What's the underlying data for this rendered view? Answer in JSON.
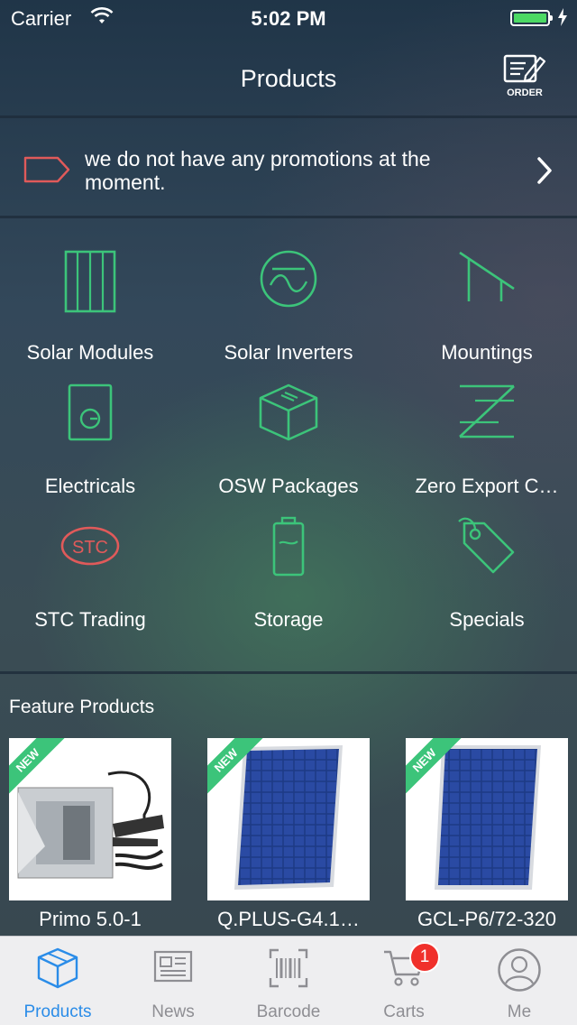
{
  "status": {
    "carrier": "Carrier",
    "time": "5:02 PM"
  },
  "nav": {
    "title": "Products",
    "order_label": "ORDER"
  },
  "promo": {
    "text": "we do not have any promotions at the moment."
  },
  "categories": [
    {
      "label": "Solar Modules",
      "icon": "solar-panel-icon"
    },
    {
      "label": "Solar Inverters",
      "icon": "inverter-icon"
    },
    {
      "label": "Mountings",
      "icon": "mounting-icon"
    },
    {
      "label": "Electricals",
      "icon": "electrical-icon"
    },
    {
      "label": "OSW Packages",
      "icon": "package-icon"
    },
    {
      "label": "Zero Export C…",
      "icon": "zero-export-icon"
    },
    {
      "label": "STC Trading",
      "icon": "stc-icon"
    },
    {
      "label": "Storage",
      "icon": "battery-icon"
    },
    {
      "label": "Specials",
      "icon": "tag-icon"
    }
  ],
  "featured": {
    "title": "Feature Products",
    "ribbon": "NEW",
    "items": [
      {
        "name": "Primo 5.0-1",
        "image": "microinverter-image"
      },
      {
        "name": "Q.PLUS-G4.1…",
        "image": "solar-panel-image"
      },
      {
        "name": "GCL-P6/72-320",
        "image": "solar-panel-image"
      }
    ]
  },
  "tabs": [
    {
      "label": "Products",
      "active": true
    },
    {
      "label": "News",
      "active": false
    },
    {
      "label": "Barcode",
      "active": false
    },
    {
      "label": "Carts",
      "active": false,
      "badge": "1"
    },
    {
      "label": "Me",
      "active": false
    }
  ],
  "colors": {
    "accent_green": "#3cc47a",
    "stc_red": "#e05a5a",
    "tab_active": "#2a8ce8",
    "badge": "#f0302b"
  }
}
